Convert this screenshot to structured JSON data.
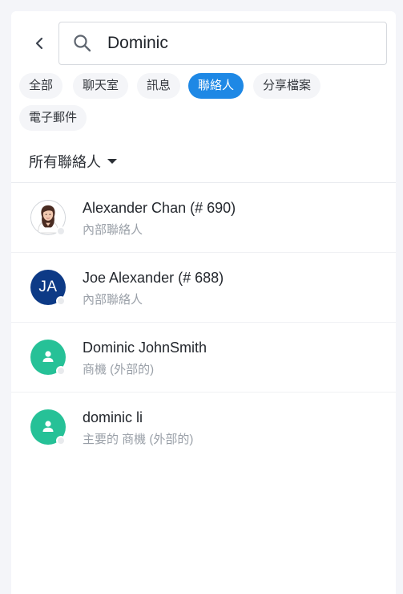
{
  "search": {
    "query": "Dominic",
    "back_icon": "chevron-left-icon",
    "search_icon": "search-icon"
  },
  "filters": [
    {
      "label": "全部",
      "active": false
    },
    {
      "label": "聊天室",
      "active": false
    },
    {
      "label": "訊息",
      "active": false
    },
    {
      "label": "聯絡人",
      "active": true
    },
    {
      "label": "分享檔案",
      "active": false
    },
    {
      "label": "電子郵件",
      "active": false
    }
  ],
  "section": {
    "label": "所有聯絡人",
    "icon": "caret-down-icon"
  },
  "contacts": [
    {
      "name": "Alexander Chan (# 690)",
      "subtitle": "內部聯絡人",
      "avatar_type": "photo",
      "avatar_text": ""
    },
    {
      "name": "Joe Alexander (# 688)",
      "subtitle": "內部聯絡人",
      "avatar_type": "initials",
      "avatar_text": "JA"
    },
    {
      "name": "Dominic JohnSmith",
      "subtitle": "商機 (外部的)",
      "avatar_type": "generic",
      "avatar_text": ""
    },
    {
      "name": "dominic li",
      "subtitle": "主要的 商機 (外部的)",
      "avatar_type": "generic",
      "avatar_text": ""
    }
  ],
  "colors": {
    "accent": "#1e88e5",
    "generic_avatar": "#26c197",
    "initials_avatar": "#0d3a86"
  }
}
